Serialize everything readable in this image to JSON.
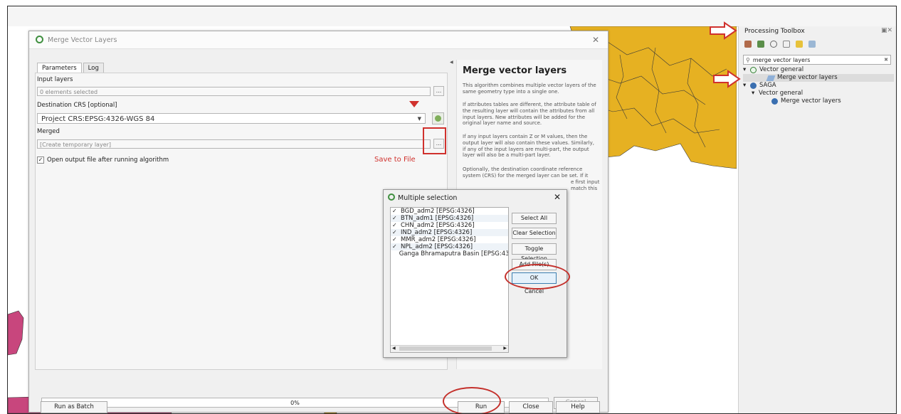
{
  "dialog": {
    "title": "Merge Vector Layers",
    "tabs": [
      "Parameters",
      "Log"
    ],
    "input_layers_label": "Input layers",
    "input_layers_value": "0 elements selected",
    "dest_crs_label": "Destination CRS [optional]",
    "dest_crs_value": "Project CRS:EPSG:4326-WGS 84",
    "merged_label": "Merged",
    "merged_placeholder": "[Create temporary layer]",
    "open_output_label": "Open output file after running algorithm",
    "save_to_file_note": "Save to File",
    "browse_label": "...",
    "progress_text": "0%",
    "cancel_label": "Cancel",
    "batch_label": "Run as Batch Process...",
    "run_label": "Run",
    "close_label": "Close",
    "help_label": "Help"
  },
  "help": {
    "title": "Merge vector layers",
    "p1": "This algorithm combines multiple vector layers of the same geometry type into a single one.",
    "p2": "If attributes tables are different, the attribute table of the resulting layer will contain the attributes from all input layers. New attributes will be added for the original layer name and source.",
    "p3": "If any input layers contain Z or M values, then the output layer will also contain these values. Similarly, if any of the input layers are multi-part, the output layer will also be a multi-part layer.",
    "p4": "Optionally, the destination coordinate reference system (CRS) for the merged layer can be set. If it",
    "p5": "e first input",
    "p6": "match this"
  },
  "multi_select": {
    "title": "Multiple selection",
    "items": [
      {
        "label": "BGD_adm2 [EPSG:4326]",
        "checked": true
      },
      {
        "label": "BTN_adm1 [EPSG:4326]",
        "checked": true
      },
      {
        "label": "CHN_adm2 [EPSG:4326]",
        "checked": true
      },
      {
        "label": "IND_adm2 [EPSG:4326]",
        "checked": true
      },
      {
        "label": "MMR_adm2 [EPSG:4326]",
        "checked": true
      },
      {
        "label": "NPL_adm2 [EPSG:4326]",
        "checked": true
      },
      {
        "label": "Ganga Bhramaputra Basin [EPSG:43",
        "checked": false
      }
    ],
    "buttons": {
      "select_all": "Select All",
      "clear_selection": "Clear Selection",
      "toggle_selection": "Toggle Selection",
      "add_files": "Add File(s)",
      "ok": "OK",
      "cancel": "Cancel"
    }
  },
  "toolbox": {
    "title": "Processing Toolbox",
    "search_value": "merge vector layers",
    "tree": {
      "group1": "Vector general",
      "group1_item": "Merge vector layers",
      "provider2": "SAGA",
      "group2": "Vector general",
      "group2_item": "Merge vector layers"
    }
  },
  "colors": {
    "annotation_red": "#d0312d",
    "map_yellow": "#e6b122",
    "map_pink": "#c8467d",
    "qgis_green": "#3f8f3f"
  }
}
